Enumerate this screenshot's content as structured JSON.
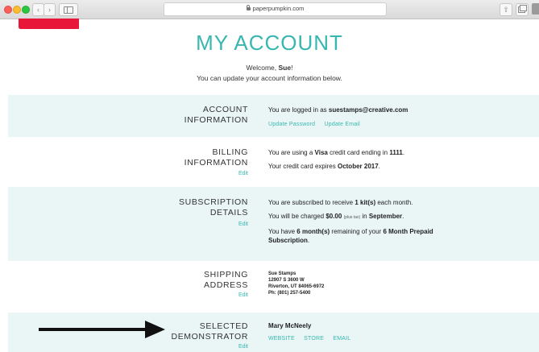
{
  "browser": {
    "url": "paperpumpkin.com"
  },
  "header": {
    "title": "MY ACCOUNT",
    "welcome_prefix": "Welcome, ",
    "welcome_name": "Sue",
    "welcome_suffix": "!",
    "subtitle": "You can update your account information below."
  },
  "account": {
    "label_1": "ACCOUNT",
    "label_2": "INFORMATION",
    "logged_prefix": "You are logged in as ",
    "email": "suestamps@creative.com",
    "update_password": "Update Password",
    "update_email": "Update Email"
  },
  "billing": {
    "label_1": "BILLING",
    "label_2": "INFORMATION",
    "edit": "Edit",
    "line1_a": "You are using a ",
    "card_type": "Visa",
    "line1_b": " credit card ending in ",
    "last4": "1111",
    "line1_c": ".",
    "line2_a": "Your credit card expires ",
    "expiry": "October 2017",
    "line2_b": "."
  },
  "subscription": {
    "label_1": "SUBSCRIPTION",
    "label_2": "DETAILS",
    "edit": "Edit",
    "line1_a": "You are subscribed to receive ",
    "kits": "1 kit(s)",
    "line1_b": " each month.",
    "line2_a": "You will be charged ",
    "charge": "$0.00",
    "plus_tax": "(plus tax)",
    "line2_b": " in ",
    "month": "September",
    "line2_c": ".",
    "line3_a": "You have ",
    "remaining": "6 month(s)",
    "line3_b": " remaining of your ",
    "plan": "6 Month Prepaid",
    "line3_c": "Subscription",
    "line3_d": "."
  },
  "shipping": {
    "label_1": "SHIPPING",
    "label_2": "ADDRESS",
    "edit": "Edit",
    "name": "Sue Stamps",
    "street": "12907 S 3600 W",
    "city": "Riverton, UT 84065-6972",
    "phone": "Ph: (801) 257-5400"
  },
  "demonstrator": {
    "label_1": "SELECTED",
    "label_2": "DEMONSTRATOR",
    "edit": "Edit",
    "name": "Mary McNeely",
    "website": "WEBSITE",
    "store": "STORE",
    "email": "EMAIL"
  },
  "colors": {
    "accent": "#38b7b0",
    "shade": "#eaf6f6",
    "decoration": "#e8173a"
  }
}
